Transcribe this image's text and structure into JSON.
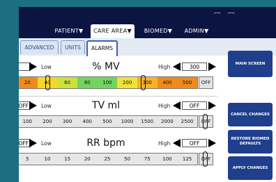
{
  "menu": {
    "tabs": [
      {
        "label": "PATIENT▼"
      },
      {
        "label": "CARE AREA▼"
      },
      {
        "label": "BIOMED▼"
      },
      {
        "label": "ADMIN▼"
      }
    ]
  },
  "subtabs": [
    {
      "label": "ADVANCED"
    },
    {
      "label": "UNITS"
    },
    {
      "label": "ALARMS"
    }
  ],
  "rows": [
    {
      "title": "% MV",
      "low_label": "Low",
      "high_label": "High",
      "high_value": "300",
      "scale": [
        "20",
        "40",
        "60",
        "80",
        "100",
        "200",
        "300",
        "400",
        "500",
        "OFF"
      ],
      "colors": [
        "#f08a1d",
        "#f5d72a",
        "#cbe23d",
        "#72d45e",
        "#72d45e",
        "#f0e23a",
        "#f5b22a",
        "#f08a1d",
        "#f08a1d"
      ],
      "low_handle_value": "40",
      "high_handle_value": "300"
    },
    {
      "title": "TV ml",
      "low_label": "Low",
      "high_label": "High",
      "low_value": "OFF",
      "high_value": "OFF",
      "scale": [
        "100",
        "200",
        "300",
        "400",
        "500",
        "1000",
        "1500",
        "2000",
        "2500",
        "OFF"
      ]
    },
    {
      "title": "RR bpm",
      "low_label": "Low",
      "high_label": "High",
      "low_value": "OFF",
      "high_value": "OFF",
      "scale": [
        "5",
        "10",
        "15",
        "20",
        "25",
        "50",
        "75",
        "100",
        "125",
        "OFF"
      ]
    }
  ],
  "buttons": {
    "main_screen": "MAIN SCREEN",
    "cancel_changes": "CANCEL CHANGES",
    "restore_biomed_defaults": "RESTORE BIOMED DEFAULTS",
    "apply_changes": "APPLY CHANGES"
  }
}
